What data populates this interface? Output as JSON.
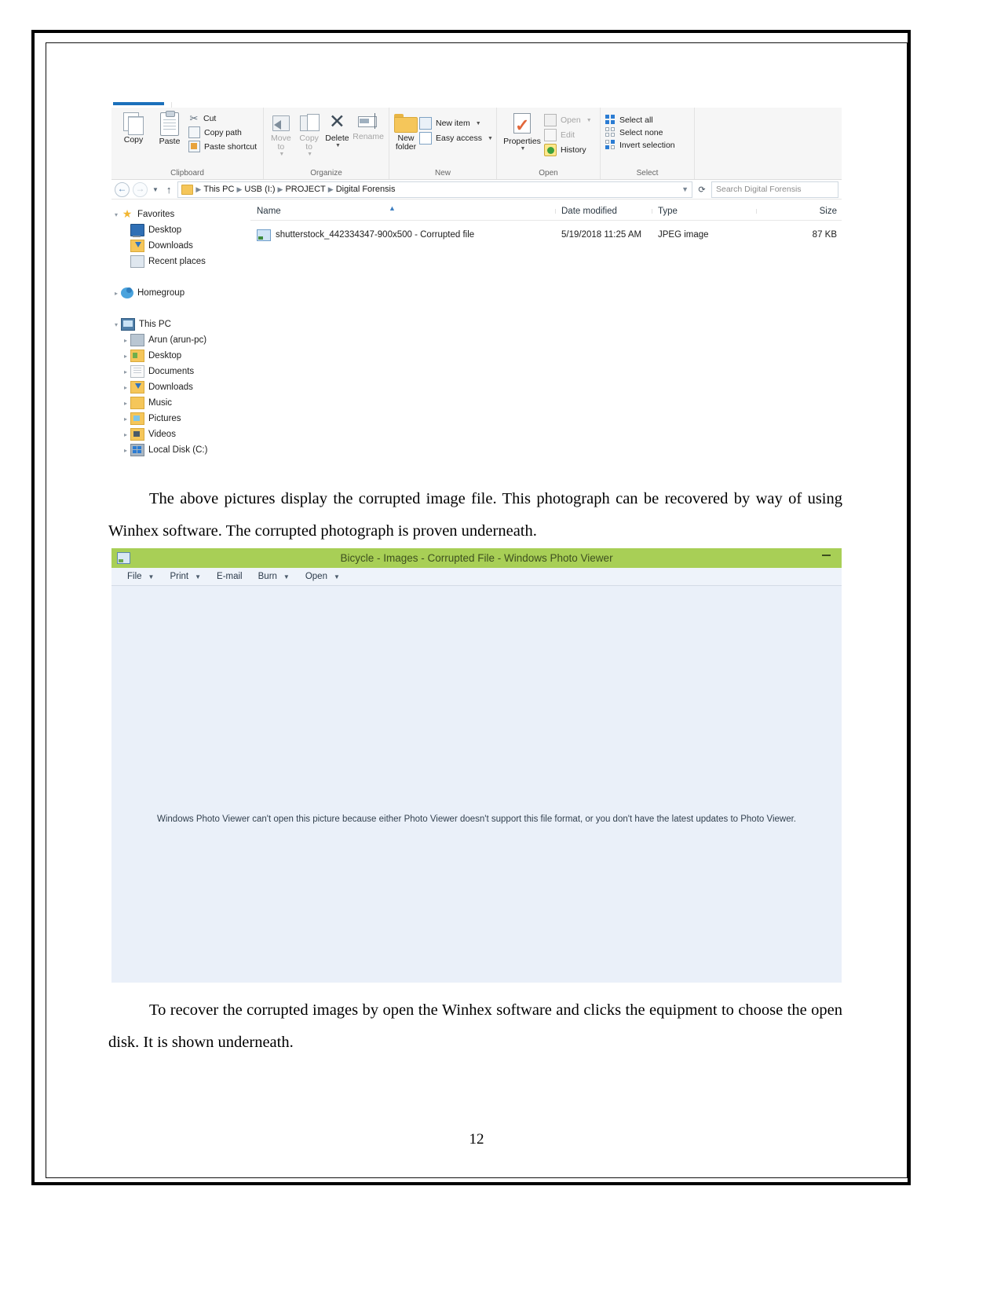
{
  "document": {
    "page_number": "12",
    "paragraphs": [
      "The above pictures display the corrupted image file. This photograph can be recovered by way of using Winhex software. The corrupted photograph is proven underneath.",
      "To recover the corrupted images by open the Winhex software and clicks the equipment to choose the open disk. It is shown underneath."
    ]
  },
  "explorer": {
    "ribbon": {
      "groups": [
        {
          "title": "Clipboard",
          "big_buttons": [
            {
              "label": "Copy",
              "icon": "copy-icon",
              "disabled": false
            },
            {
              "label": "Paste",
              "icon": "paste-clipboard-icon",
              "disabled": false
            }
          ],
          "small_buttons": [
            {
              "label": "Cut",
              "icon": "scissors-icon"
            },
            {
              "label": "Copy path",
              "icon": "copy-path-icon"
            },
            {
              "label": "Paste shortcut",
              "icon": "paste-shortcut-icon"
            }
          ]
        },
        {
          "title": "Organize",
          "big_buttons": [
            {
              "label": "Move to",
              "icon": "move-to-icon",
              "disabled": true,
              "caret": true
            },
            {
              "label": "Copy to",
              "icon": "copy-to-icon",
              "disabled": true,
              "caret": true
            },
            {
              "label": "Delete",
              "icon": "delete-x-icon",
              "disabled": false,
              "caret": true
            },
            {
              "label": "Rename",
              "icon": "rename-icon",
              "disabled": true
            }
          ]
        },
        {
          "title": "New",
          "big_buttons": [
            {
              "label": "New folder",
              "icon": "new-folder-icon",
              "disabled": false
            }
          ],
          "small_buttons": [
            {
              "label": "New item",
              "icon": "new-item-icon",
              "caret": true
            },
            {
              "label": "Easy access",
              "icon": "easy-access-icon",
              "caret": true
            }
          ]
        },
        {
          "title": "Open",
          "big_buttons": [
            {
              "label": "Properties",
              "icon": "properties-icon",
              "disabled": false,
              "caret": true
            }
          ],
          "small_buttons": [
            {
              "label": "Open",
              "icon": "open-icon",
              "caret": true,
              "disabled": true
            },
            {
              "label": "Edit",
              "icon": "edit-icon",
              "disabled": true
            },
            {
              "label": "History",
              "icon": "history-icon",
              "disabled": false
            }
          ]
        },
        {
          "title": "Select",
          "small_buttons": [
            {
              "label": "Select all",
              "icon": "select-all-icon"
            },
            {
              "label": "Select none",
              "icon": "select-none-icon"
            },
            {
              "label": "Invert selection",
              "icon": "invert-selection-icon"
            }
          ]
        }
      ]
    },
    "address_bar": {
      "back_icon": "back-arrow-icon",
      "forward_icon": "forward-arrow-icon",
      "recent_icon": "recent-locations-icon",
      "up_icon": "up-arrow-icon",
      "breadcrumbs": [
        "This PC",
        "USB (I:)",
        "PROJECT",
        "Digital Forensis"
      ],
      "refresh_icon": "refresh-icon",
      "search_placeholder": "Search Digital Forensis"
    },
    "nav_pane": [
      {
        "label": "Favorites",
        "icon": "favorites-star-icon",
        "indent": 0,
        "expander": "expanded"
      },
      {
        "label": "Desktop",
        "icon": "desktop-icon",
        "indent": 1,
        "expander": "none"
      },
      {
        "label": "Downloads",
        "icon": "downloads-icon",
        "indent": 1,
        "expander": "none"
      },
      {
        "label": "Recent places",
        "icon": "recent-places-icon",
        "indent": 1,
        "expander": "none"
      },
      {
        "label": "",
        "icon": "",
        "indent": 0,
        "expander": "none"
      },
      {
        "label": "Homegroup",
        "icon": "homegroup-icon",
        "indent": 0,
        "expander": "collapsed"
      },
      {
        "label": "",
        "icon": "",
        "indent": 0,
        "expander": "none"
      },
      {
        "label": "This PC",
        "icon": "this-pc-icon",
        "indent": 0,
        "expander": "expanded"
      },
      {
        "label": "Arun (arun-pc)",
        "icon": "user-folder-icon",
        "indent": 1,
        "expander": "collapsed"
      },
      {
        "label": "Desktop",
        "icon": "desktop-folder-icon",
        "indent": 1,
        "expander": "collapsed"
      },
      {
        "label": "Documents",
        "icon": "documents-folder-icon",
        "indent": 1,
        "expander": "collapsed"
      },
      {
        "label": "Downloads",
        "icon": "downloads-folder-icon",
        "indent": 1,
        "expander": "collapsed"
      },
      {
        "label": "Music",
        "icon": "music-folder-icon",
        "indent": 1,
        "expander": "collapsed"
      },
      {
        "label": "Pictures",
        "icon": "pictures-folder-icon",
        "indent": 1,
        "expander": "collapsed"
      },
      {
        "label": "Videos",
        "icon": "videos-folder-icon",
        "indent": 1,
        "expander": "collapsed"
      },
      {
        "label": "Local Disk (C:)",
        "icon": "local-disk-icon",
        "indent": 1,
        "expander": "collapsed"
      }
    ],
    "columns": [
      "Name",
      "Date modified",
      "Type",
      "Size"
    ],
    "sort_indicator": "ascending",
    "files": [
      {
        "name": "shutterstock_442334347-900x500 - Corrupted file",
        "date_modified": "5/19/2018 11:25 AM",
        "type": "JPEG image",
        "size": "87 KB",
        "icon": "jpeg-image-icon"
      }
    ]
  },
  "photo_viewer": {
    "title": "Bicycle - Images - Corrupted File - Windows Photo Viewer",
    "title_icon": "photo-viewer-icon",
    "minimize_label": "",
    "title_bar_color": "#a8cf56",
    "menu": [
      {
        "label": "File",
        "caret": true
      },
      {
        "label": "Print",
        "caret": true
      },
      {
        "label": "E-mail",
        "caret": false
      },
      {
        "label": "Burn",
        "caret": true
      },
      {
        "label": "Open",
        "caret": true
      }
    ],
    "error_message": "Windows Photo Viewer can't open this picture because either Photo Viewer doesn't support this file format, or you don't have the latest updates to Photo Viewer."
  }
}
